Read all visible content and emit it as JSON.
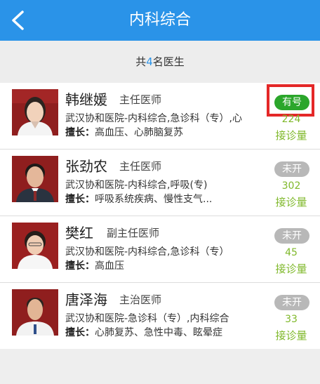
{
  "header": {
    "title": "内科综合",
    "back_icon": "chevron-left-icon",
    "background_color": "#2a93e8"
  },
  "summary": {
    "prefix": "共",
    "count": "4",
    "suffix": "名医生"
  },
  "doctors": [
    {
      "name": "韩继媛",
      "title": "主任医师",
      "hospital": "武汉协和医院-内科综合,急诊科（专）,心",
      "specialty_label": "擅长：",
      "specialty": "高血压、心肺脑复苏",
      "status": "有号",
      "status_color": "#2ba62b",
      "visits": "224",
      "visits_label": "接诊量"
    },
    {
      "name": "张劲农",
      "title": "主任医师",
      "hospital": "武汉协和医院-内科综合,呼吸(专)",
      "specialty_label": "擅长：",
      "specialty": "呼吸系统疾病、慢性支气...",
      "status": "未开",
      "status_color": "#b8b8b8",
      "visits": "302",
      "visits_label": "接诊量"
    },
    {
      "name": "樊红",
      "title": "副主任医师",
      "hospital": "武汉协和医院-内科综合,急诊科（专）",
      "specialty_label": "擅长：",
      "specialty": "高血压",
      "status": "未开",
      "status_color": "#b8b8b8",
      "visits": "45",
      "visits_label": "接诊量"
    },
    {
      "name": "唐泽海",
      "title": "主治医师",
      "hospital": "武汉协和医院-急诊科（专）,内科综合",
      "specialty_label": "擅长：",
      "specialty": "心肺复苏、急性中毒、眩晕症",
      "status": "未开",
      "status_color": "#b8b8b8",
      "visits": "33",
      "visits_label": "接诊量"
    }
  ],
  "highlight_color": "#e42828",
  "accent_green": "#7fb82a"
}
